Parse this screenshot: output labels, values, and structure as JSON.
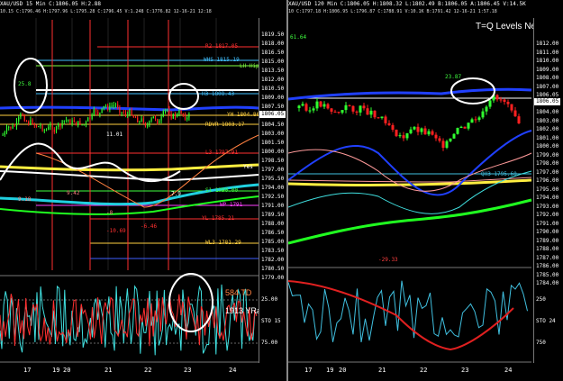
{
  "left_chart": {
    "header": "XAU/USD 15 Min C:1806.05 H:2.88",
    "subheader": "10.15 C:1796.46 H:1797.96 L:1795.28 C:1796.45 V:1.248 C:1776.82 12-16-21 12:18",
    "price_ticks": [
      "1819.50",
      "1818.00",
      "1816.50",
      "1815.00",
      "1813.50",
      "1812.00",
      "1810.50",
      "1809.00",
      "1807.50",
      "1806.05",
      "1804.50",
      "1803.00",
      "1801.50",
      "1800.00",
      "1798.50",
      "1797.00",
      "1795.50",
      "1794.00",
      "1792.50",
      "1791.00",
      "1789.50",
      "1788.00",
      "1786.50",
      "1785.00",
      "1783.50",
      "1782.00",
      "1780.50",
      "1779.00"
    ],
    "current_price": "1806.05",
    "levels": [
      {
        "label": "R2 1817.05",
        "color": "#ff3030"
      },
      {
        "label": "WHS 1815.19",
        "color": "#40c0ff"
      },
      {
        "label": "LH Hip",
        "color": "#80ff40"
      },
      {
        "label": "H3 1808.43",
        "color": "#40c0ff"
      },
      {
        "label": "YH 1804.86",
        "color": "#ffd040"
      },
      {
        "label": "RDVR 1803.17",
        "color": "#ffd040"
      },
      {
        "label": "L3 1797.91",
        "color": "#ff3030"
      },
      {
        "label": "Yes",
        "color": "#ffffff"
      },
      {
        "label": "S1 1790.00",
        "color": "#40ff40"
      },
      {
        "label": "WP 1791",
        "color": "#ff40ff"
      },
      {
        "label": "YL 1785.21",
        "color": "#ff3030"
      },
      {
        "label": "WL3 1781.29",
        "color": "#ffd040"
      }
    ],
    "annotations": [
      "11.01",
      "9.42",
      "9.18",
      "7.9",
      "-8",
      "-10.69",
      "-6.46",
      "25.8"
    ],
    "osc_text": {
      "td": "584 TD",
      "yrange": "1913 YRange"
    },
    "osc_ticks": [
      "25.00",
      "STO 15",
      "75.00"
    ],
    "date_labels": [
      "17",
      "19",
      "20",
      "21",
      "22",
      "23",
      "24"
    ]
  },
  "right_chart": {
    "header": "XAU/USD 120 Min C:1806.05 H:1808.32 L:1802.49 B:1806.05 A:1806.45 V:14.5K",
    "subheader": "10 C:1797.18 H:1806.95 L:1796.87 C:1788.91 V:10.1K B:1791.42 12-16-21 1:57.18",
    "title": "T=Q Levels Ne",
    "price_ticks": [
      "1812.00",
      "1811.00",
      "1810.00",
      "1809.00",
      "1808.00",
      "1807.00",
      "1806.05",
      "1805.00",
      "1804.00",
      "1803.00",
      "1802.00",
      "1801.00",
      "1800.00",
      "1799.00",
      "1798.00",
      "1797.00",
      "1796.00",
      "1795.00",
      "1794.00",
      "1793.00",
      "1792.00",
      "1791.00",
      "1790.00",
      "1789.00",
      "1788.00",
      "1787.00",
      "1786.00",
      "1785.00",
      "1784.00"
    ],
    "current_price": "1806.05",
    "level_label": "QH3 1795.60",
    "annotations": [
      "61.64",
      "23.87",
      "-29.33"
    ],
    "osc_ticks": [
      "250",
      "STO 24",
      "750"
    ],
    "date_labels": [
      "17",
      "19",
      "20",
      "21",
      "22",
      "23",
      "24"
    ]
  },
  "colors": {
    "bull": "#30ff30",
    "bear": "#ff2020",
    "ma_blue": "#2040ff",
    "ma_yellow": "#ffee40",
    "ma_green": "#20ff20",
    "ma_cyan": "#20d0e0",
    "annotation": "#ffffff"
  }
}
